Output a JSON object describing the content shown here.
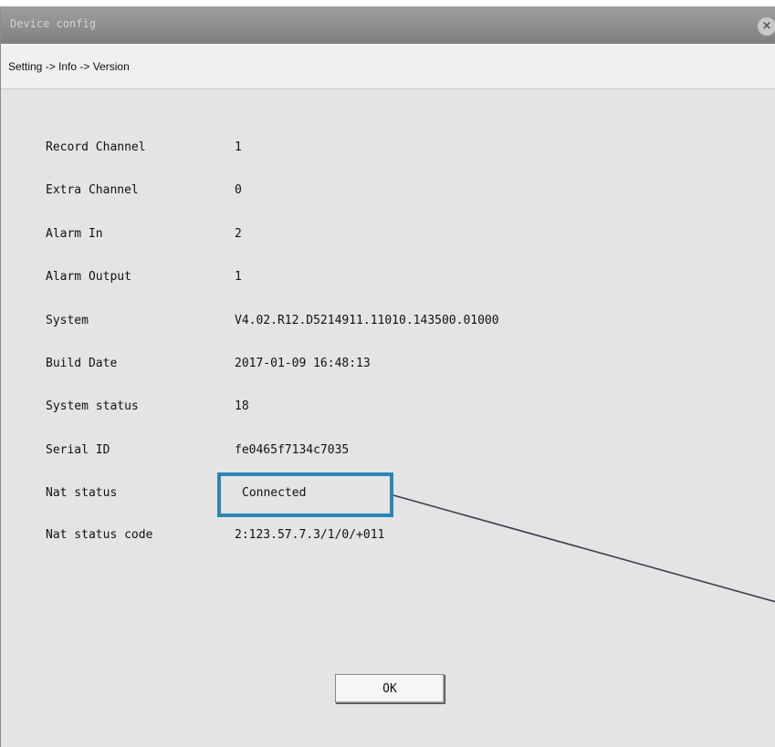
{
  "window": {
    "title": "Device config",
    "close_label": "×"
  },
  "breadcrumb": "Setting -> Info -> Version",
  "info": [
    {
      "label": "Record Channel",
      "value": "1"
    },
    {
      "label": "Extra Channel",
      "value": "0"
    },
    {
      "label": "Alarm In",
      "value": "2"
    },
    {
      "label": "Alarm Output",
      "value": "1"
    },
    {
      "label": "System",
      "value": "V4.02.R12.D5214911.11010.143500.01000"
    },
    {
      "label": "Build Date",
      "value": "2017-01-09 16:48:13"
    },
    {
      "label": "System status",
      "value": "18"
    },
    {
      "label": "Serial ID",
      "value": "fe0465f7134c7035"
    },
    {
      "label": "Nat status",
      "value": "Connected"
    },
    {
      "label": "Nat status code",
      "value": "2:123.57.7.3/1/0/+011"
    }
  ],
  "ok_label": "OK",
  "highlight_color": "#2a86b6"
}
